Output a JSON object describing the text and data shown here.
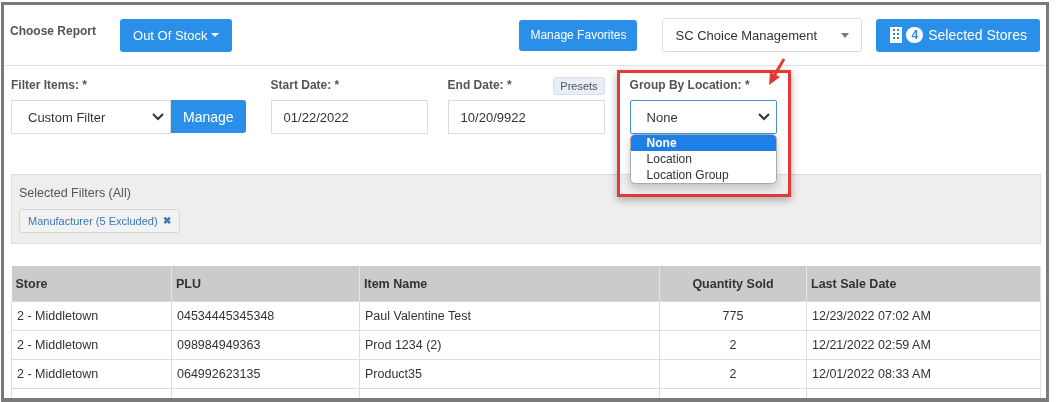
{
  "report_label": "Choose Report",
  "report_button": "Out Of Stock",
  "favorites_button": "Manage Favorites",
  "company_select": "SC Choice Management",
  "stores_button": {
    "count": "4",
    "label": "Selected Stores"
  },
  "filters": {
    "filter_items": {
      "label": "Filter Items: *",
      "value": "Custom Filter",
      "button": "Manage"
    },
    "start_date": {
      "label": "Start Date: *",
      "value": "01/22/2022"
    },
    "end_date": {
      "label": "End Date: *",
      "value": "10/20/9922",
      "presets": "Presets"
    },
    "group_by": {
      "label": "Group By Location: *",
      "value": "None",
      "expanded": true,
      "highlighted": true,
      "options": [
        {
          "label": "None",
          "selected": true
        },
        {
          "label": "Location",
          "selected": false
        },
        {
          "label": "Location Group",
          "selected": false
        }
      ]
    }
  },
  "selected_filters": {
    "title": "Selected Filters (All)",
    "tags": [
      {
        "label": "Manufacturer (5 Excluded)",
        "remove": "✖"
      }
    ]
  },
  "table": {
    "columns": [
      {
        "label": "Store",
        "centered": false
      },
      {
        "label": "PLU",
        "centered": false
      },
      {
        "label": "Item Name",
        "centered": false
      },
      {
        "label": "Quantity Sold",
        "centered": true
      },
      {
        "label": "Last Sale Date",
        "centered": false
      }
    ],
    "rows": [
      [
        "2 - Middletown",
        "04534445345348",
        "Paul Valentine Test",
        "775",
        "12/23/2022 07:02 AM"
      ],
      [
        "2 - Middletown",
        "098984949363",
        "Prod 1234 (2)",
        "2",
        "12/21/2022 02:59 AM"
      ],
      [
        "2 - Middletown",
        "064992623135",
        "Product35",
        "2",
        "12/01/2022 08:33 AM"
      ]
    ]
  }
}
